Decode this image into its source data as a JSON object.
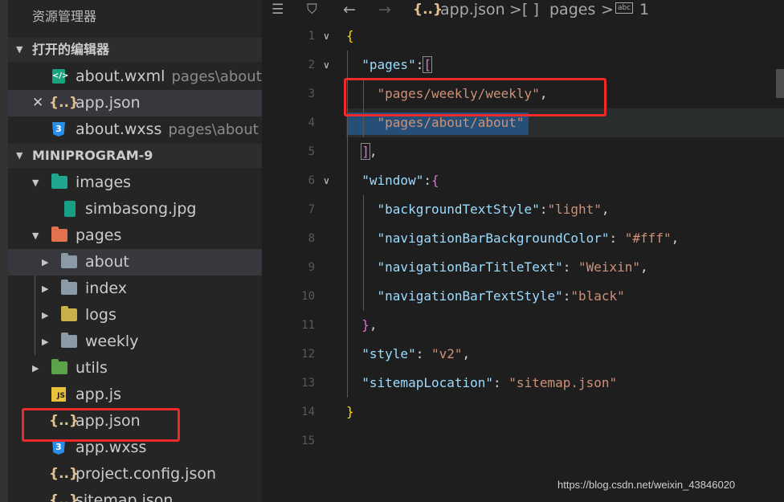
{
  "explorer": {
    "title": "资源管理器",
    "open_editors": {
      "header": "打开的编辑器",
      "items": [
        {
          "name": "about.wxml",
          "path": "pages\\about",
          "icon": "wxml-code-icon"
        },
        {
          "name": "app.json",
          "path": "",
          "icon": "json-braces-icon",
          "close": "✕"
        },
        {
          "name": "about.wxss",
          "path": "pages\\about",
          "icon": "css-icon"
        }
      ]
    },
    "project": {
      "header": "MINIPROGRAM-9",
      "items": [
        {
          "name": "images",
          "kind": "folder",
          "icon": "images-folder-icon"
        },
        {
          "name": "simbasong.jpg",
          "kind": "file",
          "icon": "image-file-icon"
        },
        {
          "name": "pages",
          "kind": "folder",
          "icon": "pages-folder-icon"
        },
        {
          "name": "about",
          "kind": "folder",
          "icon": "folder-icon"
        },
        {
          "name": "index",
          "kind": "folder",
          "icon": "folder-icon"
        },
        {
          "name": "logs",
          "kind": "folder",
          "icon": "folder-icon"
        },
        {
          "name": "weekly",
          "kind": "folder",
          "icon": "folder-icon"
        },
        {
          "name": "utils",
          "kind": "folder",
          "icon": "utils-folder-icon"
        },
        {
          "name": "app.js",
          "kind": "file",
          "icon": "js-icon"
        },
        {
          "name": "app.json",
          "kind": "file",
          "icon": "json-braces-icon"
        },
        {
          "name": "app.wxss",
          "kind": "file",
          "icon": "css-icon"
        },
        {
          "name": "project.config.json",
          "kind": "file",
          "icon": "json-braces-icon"
        },
        {
          "name": "sitemap.json",
          "kind": "file",
          "icon": "json-braces-icon"
        }
      ]
    }
  },
  "breadcrumb": {
    "file_icon": "{..}",
    "file": "app.json",
    "sep": ">",
    "node_icon": "[ ]",
    "node": "pages",
    "item_icon": "abc",
    "item": "1"
  },
  "editor": {
    "lines": [
      {
        "n": "1",
        "fold": "∨"
      },
      {
        "n": "2",
        "fold": "∨"
      },
      {
        "n": "3",
        "fold": ""
      },
      {
        "n": "4",
        "fold": ""
      },
      {
        "n": "5",
        "fold": ""
      },
      {
        "n": "6",
        "fold": "∨"
      },
      {
        "n": "7",
        "fold": ""
      },
      {
        "n": "8",
        "fold": ""
      },
      {
        "n": "9",
        "fold": ""
      },
      {
        "n": "10",
        "fold": ""
      },
      {
        "n": "11",
        "fold": ""
      },
      {
        "n": "12",
        "fold": ""
      },
      {
        "n": "13",
        "fold": ""
      },
      {
        "n": "14",
        "fold": ""
      },
      {
        "n": "15",
        "fold": ""
      }
    ],
    "code": {
      "l1": {
        "open": "{"
      },
      "l2": {
        "key": "\"pages\"",
        "colon": ":",
        "open": "["
      },
      "l3": {
        "str": "\"pages/weekly/weekly\"",
        "comma": ","
      },
      "l4": {
        "str": "\"pages/about/about\""
      },
      "l5": {
        "close": "]",
        "comma": ","
      },
      "l6": {
        "key": "\"window\"",
        "colon": ":",
        "open": "{"
      },
      "l7": {
        "key": "\"backgroundTextStyle\"",
        "colon": ":",
        "val": "\"light\"",
        "comma": ","
      },
      "l8": {
        "key": "\"navigationBarBackgroundColor\"",
        "colon": ": ",
        "val": "\"#fff\"",
        "comma": ","
      },
      "l9": {
        "key": "\"navigationBarTitleText\"",
        "colon": ": ",
        "val": "\"Weixin\"",
        "comma": ","
      },
      "l10": {
        "key": "\"navigationBarTextStyle\"",
        "colon": ":",
        "val": "\"black\""
      },
      "l11": {
        "close": "}",
        "comma": ","
      },
      "l12": {
        "key": "\"style\"",
        "colon": ": ",
        "val": "\"v2\"",
        "comma": ","
      },
      "l13": {
        "key": "\"sitemapLocation\"",
        "colon": ": ",
        "val": "\"sitemap.json\""
      },
      "l14": {
        "close": "}"
      }
    }
  },
  "watermark": "https://blog.csdn.net/weixin_43846020",
  "colors": {
    "highlight_box": "#f02a2a",
    "string": "#ce9178",
    "key": "#9cdcfe",
    "bracket_gold": "#ffd700",
    "bracket_violet": "#da70d6"
  }
}
